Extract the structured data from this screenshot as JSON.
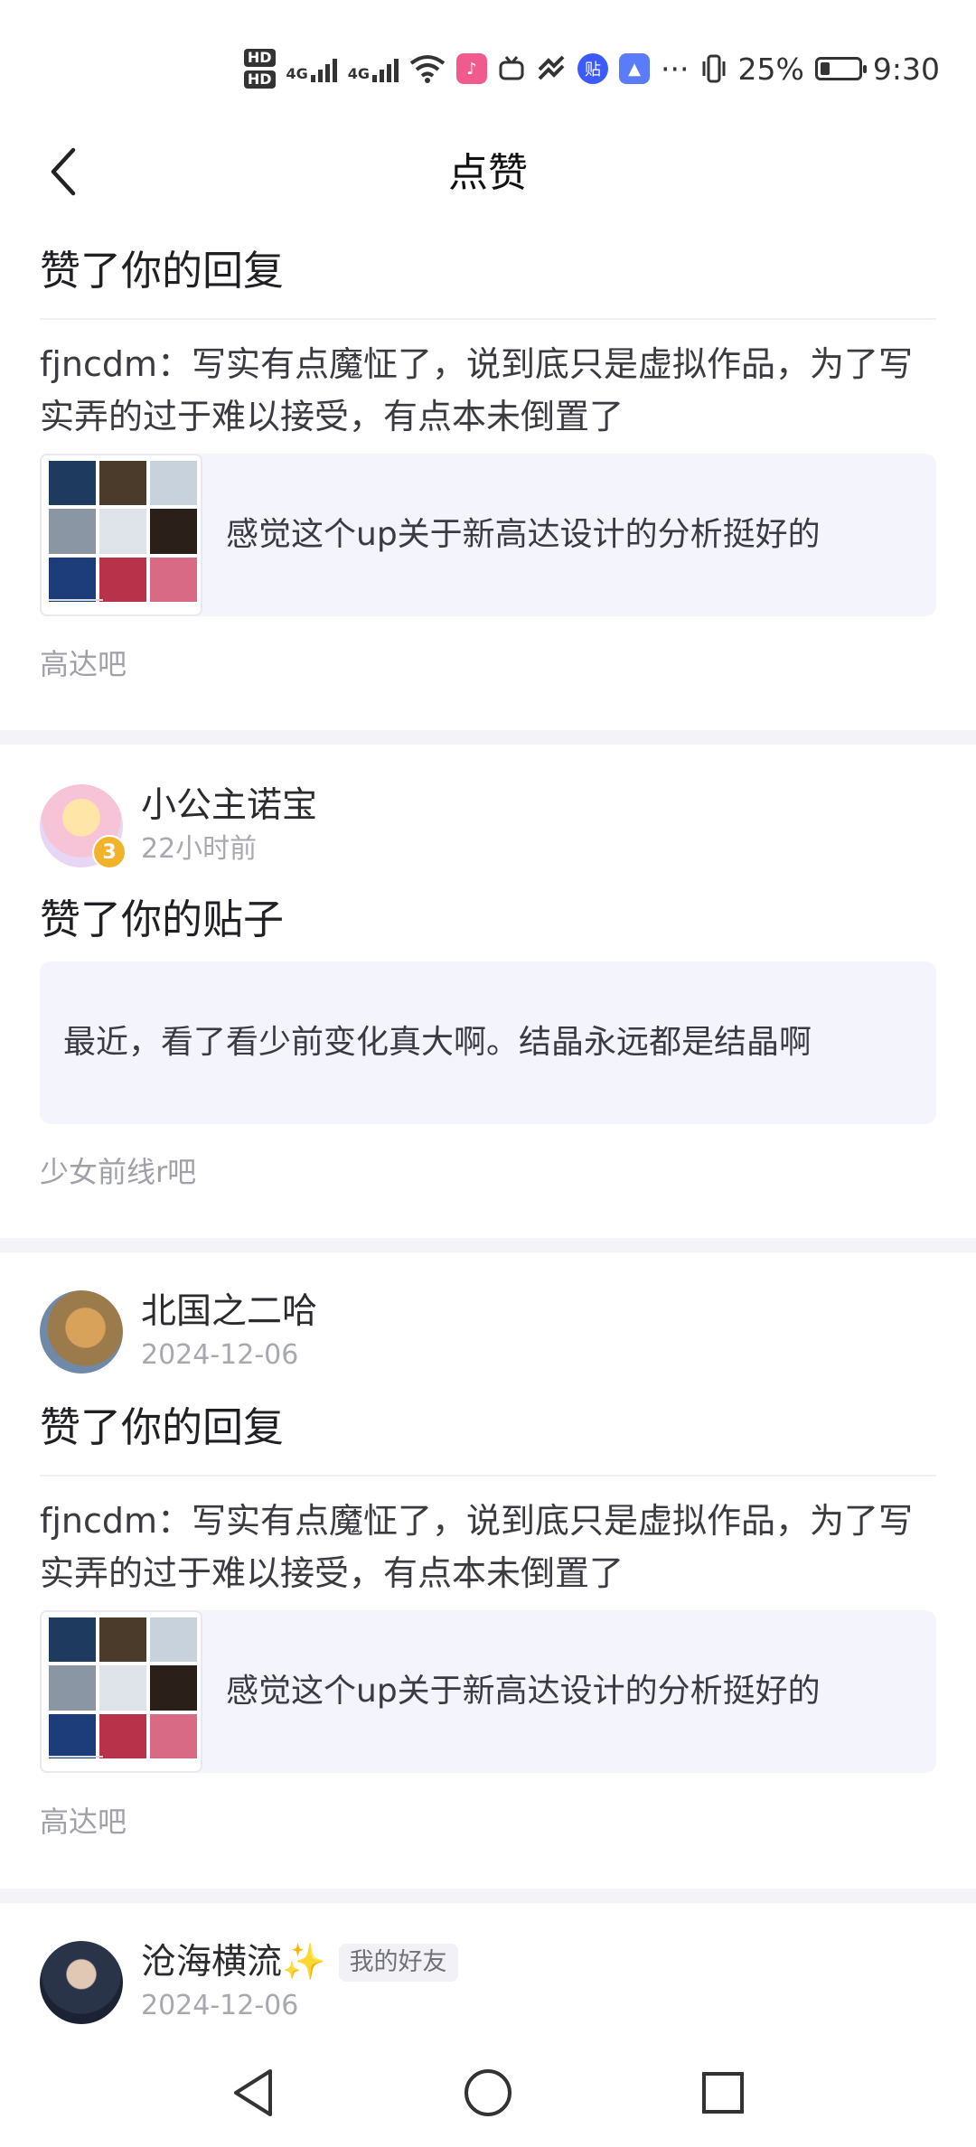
{
  "status_bar": {
    "battery_percent": "25%",
    "time": "9:30",
    "hd1": "HD",
    "hd2": "HD",
    "net1": "4G",
    "net2": "4G",
    "more": "···",
    "app_badge": "贴"
  },
  "header": {
    "title": "点赞",
    "back_icon": "chevron-left-icon"
  },
  "items": [
    {
      "action": "赞了你的回复",
      "reply_text": "fjncdm：写实有点魔怔了，说到底只是虚拟作品，为了写实弄的过于难以接受，有点本未倒置了",
      "quote_text": "感觉这个up关于新高达设计的分析挺好的",
      "forum": "高达吧"
    },
    {
      "user_name": "小公主诺宝",
      "time": "22小时前",
      "avatar_badge": "3",
      "action": "赞了你的贴子",
      "quote_text": "最近，看了看少前变化真大啊。结晶永远都是结晶啊",
      "forum": "少女前线r吧"
    },
    {
      "user_name": "北国之二哈",
      "time": "2024-12-06",
      "action": "赞了你的回复",
      "reply_text": "fjncdm：写实有点魔怔了，说到底只是虚拟作品，为了写实弄的过于难以接受，有点本未倒置了",
      "quote_text": "感觉这个up关于新高达设计的分析挺好的",
      "forum": "高达吧"
    },
    {
      "user_name": "沧海横流✨",
      "tag": "我的好友",
      "time": "2024-12-06"
    }
  ],
  "nav_bar": {
    "back": "back-triangle-icon",
    "home": "home-circle-icon",
    "recents": "recents-square-icon"
  },
  "colors": {
    "accent_bg": "#f4f4fc",
    "separator": "#f3f3f8",
    "muted_text": "#a0a0a8"
  }
}
